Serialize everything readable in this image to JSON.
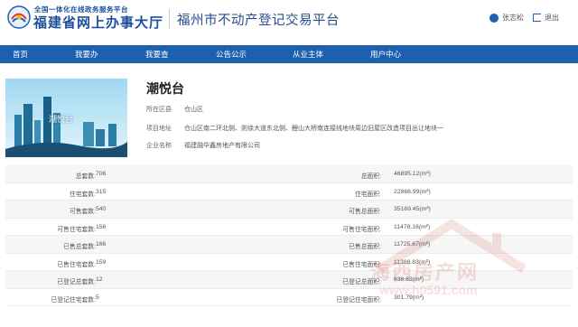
{
  "header": {
    "logo_line1": "全国一体化在线政务服务平台",
    "logo_line2": "福建省网上办事大厅",
    "site_title": "福州市不动产登记交易平台",
    "user_name": "张志松",
    "logout_label": "退出"
  },
  "nav": {
    "items": [
      {
        "label": "首页"
      },
      {
        "label": "我要办"
      },
      {
        "label": "我要查"
      },
      {
        "label": "公告公示"
      },
      {
        "label": "从业主体"
      },
      {
        "label": "用户中心"
      }
    ]
  },
  "project": {
    "thumb_caption": "潮悦台",
    "name": "潮悦台",
    "district_label": "所在区县",
    "district": "仓山区",
    "address_label": "项目地址",
    "address": "仓山区南二环北侧、则徐大道东北侧、鲤山大桥南连接线地块周边旧屋区改造项目出让地块一",
    "company_label": "企业名称",
    "company": "福建融华鑫房地产有限公司"
  },
  "stats": [
    {
      "label1": "总套数:",
      "value1": "706",
      "label2": "总面积:",
      "value2": "46895.12(m²)"
    },
    {
      "label1": "住宅套数:",
      "value1": "315",
      "label2": "住宅面积:",
      "value2": "22866.99(m²)"
    },
    {
      "label1": "可售套数:",
      "value1": "540",
      "label2": "可售总面积:",
      "value2": "35169.45(m²)"
    },
    {
      "label1": "可售住宅套数:",
      "value1": "156",
      "label2": "可售住宅面积:",
      "value2": "11478.16(m²)"
    },
    {
      "label1": "已售总套数:",
      "value1": "166",
      "label2": "已售总面积:",
      "value2": "11725.67(m²)"
    },
    {
      "label1": "已售住宅套数:",
      "value1": "159",
      "label2": "已售住宅面积:",
      "value2": "11388.83(m²)"
    },
    {
      "label1": "已登记总套数:",
      "value1": "12",
      "label2": "已登记总面积:",
      "value2": "638.63(m²)"
    },
    {
      "label1": "已登记住宅套数:",
      "value1": "5",
      "label2": "已登记住宅面积:",
      "value2": "301.79(m²)"
    }
  ],
  "watermark": {
    "text": "海西房产网",
    "url": "www.h0591.com"
  },
  "colors": {
    "brand_blue": "#1e60b0",
    "logo_blue": "#1e4f9c"
  }
}
